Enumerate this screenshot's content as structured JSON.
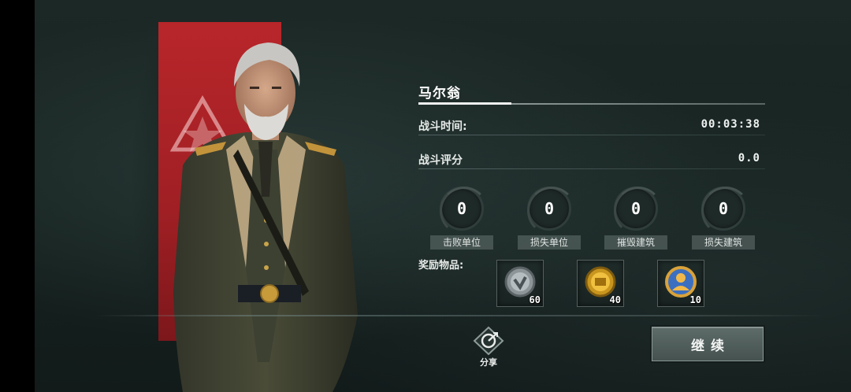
{
  "commander": {
    "name": "马尔翁"
  },
  "battle": {
    "time_label": "战斗时间:",
    "time_value": "00:03:38",
    "score_label": "战斗评分",
    "score_value": "0.0"
  },
  "stats": [
    {
      "value": "0",
      "label": "击败单位"
    },
    {
      "value": "0",
      "label": "损失单位"
    },
    {
      "value": "0",
      "label": "摧毁建筑"
    },
    {
      "value": "0",
      "label": "损失建筑"
    }
  ],
  "rewards": {
    "label": "奖励物品:",
    "items": [
      {
        "icon": "silver-coin-icon",
        "count": "60"
      },
      {
        "icon": "gold-coin-icon",
        "count": "40"
      },
      {
        "icon": "commander-medal-icon",
        "count": "10"
      }
    ]
  },
  "actions": {
    "share_label": "分享",
    "continue_label": "继续"
  },
  "colors": {
    "banner": "#b8262a",
    "background": "#182422"
  }
}
